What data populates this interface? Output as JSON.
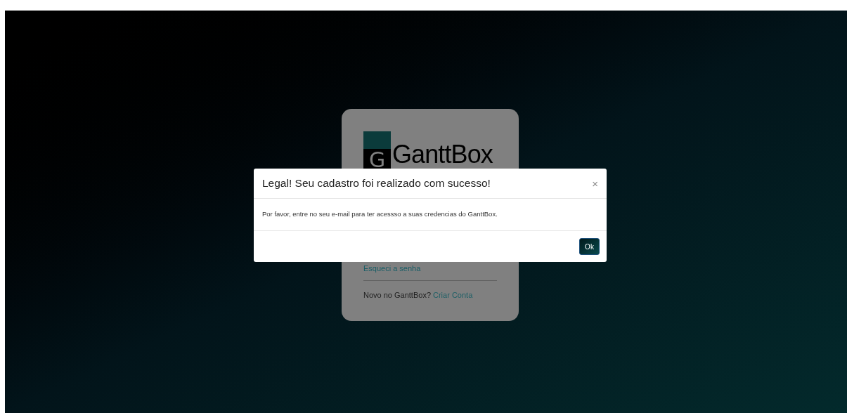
{
  "login_card": {
    "logo": {
      "mark": "G",
      "name": "GanttBox"
    },
    "forgot_password_link": "Esqueci a senha",
    "signup_prompt": "Novo no GanttBox?",
    "signup_link": "Criar Conta"
  },
  "modal": {
    "title": "Legal! Seu cadastro foi realizado com sucesso!",
    "close": "×",
    "body": "Por favor, entre no seu e-mail para ter acessso a suas credencias do GanttBox.",
    "ok_button": "Ok"
  }
}
